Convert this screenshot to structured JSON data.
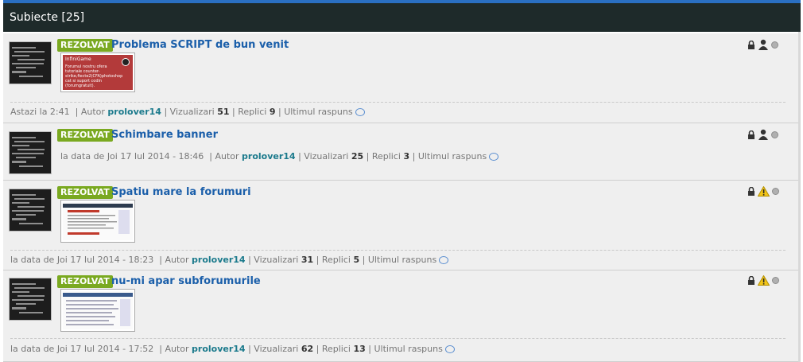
{
  "header": {
    "title": "Subiecte [25]"
  },
  "topics": [
    {
      "badge": "REZOLVAT",
      "title": "Problema SCRIPT de bun venit",
      "status_icon": "user-icon",
      "preview": {
        "type": "screenshot",
        "heading": "InfiniGame",
        "text": "Forumul nostru ofera tutoriale counter-strike,fiecte2(CFA)photoshop cat si suport codin (forumgratuit)."
      },
      "meta": {
        "date": "Astazi la 2:41",
        "author_label": "Autor",
        "author": "prolover14",
        "views_label": "Vizualizari",
        "views": "51",
        "replies_label": "Replici",
        "replies": "9",
        "last_label": "Ultimul raspuns"
      }
    },
    {
      "badge": "REZOLVAT",
      "title": "Schimbare banner",
      "status_icon": "user-icon",
      "meta": {
        "date": "la data de Joi 17 Iul 2014 - 18:46",
        "author_label": "Autor",
        "author": "prolover14",
        "views_label": "Vizualizari",
        "views": "25",
        "replies_label": "Replici",
        "replies": "3",
        "last_label": "Ultimul raspuns"
      }
    },
    {
      "badge": "REZOLVAT",
      "title": "Spatiu mare la forumuri",
      "status_icon": "warning-icon",
      "meta": {
        "date": "la data de Joi 17 Iul 2014 - 18:23",
        "author_label": "Autor",
        "author": "prolover14",
        "views_label": "Vizualizari",
        "views": "31",
        "replies_label": "Replici",
        "replies": "5",
        "last_label": "Ultimul raspuns"
      }
    },
    {
      "badge": "REZOLVAT",
      "title": "nu-mi apar subforumurile",
      "status_icon": "warning-icon",
      "meta": {
        "date": "la data de Joi 17 Iul 2014 - 17:52",
        "author_label": "Autor",
        "author": "prolover14",
        "views_label": "Vizualizari",
        "views": "62",
        "replies_label": "Replici",
        "replies": "13",
        "last_label": "Ultimul raspuns"
      }
    }
  ]
}
